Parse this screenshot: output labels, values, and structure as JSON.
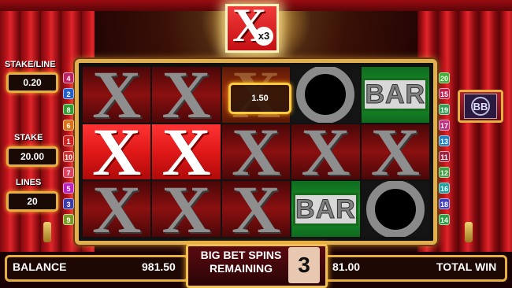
{
  "top_symbol": {
    "letter": "X",
    "multiplier": "x3"
  },
  "left_panel": {
    "stake_line_label": "STAKE/LINE",
    "stake_line_value": "0.20",
    "stake_label": "STAKE",
    "stake_value": "20.00",
    "lines_label": "LINES",
    "lines_value": "20"
  },
  "reels": [
    [
      "x-dark",
      "x-dark",
      "x-orange",
      "o-dark",
      "bar-green"
    ],
    [
      "x-red",
      "x-red",
      "x-dark",
      "x-dark",
      "x-dark"
    ],
    [
      "x-dark",
      "x-dark",
      "x-dark",
      "bar-green",
      "o-dark"
    ]
  ],
  "symbols": {
    "x": "X",
    "bar": "BAR"
  },
  "win_amount": "1.50",
  "left_lines": [
    "4",
    "2",
    "8",
    "6",
    "1",
    "10",
    "7",
    "5",
    "3",
    "9"
  ],
  "right_lines": [
    "20",
    "15",
    "19",
    "17",
    "13",
    "11",
    "12",
    "16",
    "18",
    "14"
  ],
  "line_colors": {
    "1": "#d02020",
    "2": "#2060d0",
    "3": "#3a3ab0",
    "4": "#c02060",
    "5": "#c020c0",
    "6": "#e07010",
    "7": "#e04060",
    "8": "#30a030",
    "9": "#7a9a20",
    "10": "#d03030",
    "11": "#a02040",
    "12": "#40a040",
    "13": "#2080c0",
    "14": "#2aa040",
    "15": "#c02050",
    "16": "#20a0a0",
    "17": "#c03080",
    "18": "#4040c0",
    "19": "#30a050",
    "20": "#40b030"
  },
  "logo_button": {
    "icon": "bb-logo-icon",
    "text": "BB"
  },
  "bottom": {
    "balance_label": "BALANCE",
    "balance_value": "981.50",
    "spins_label_1": "BIG BET SPINS",
    "spins_label_2": "REMAINING",
    "spins_count": "3",
    "total_win_value": "81.00",
    "total_win_label": "TOTAL WIN"
  }
}
